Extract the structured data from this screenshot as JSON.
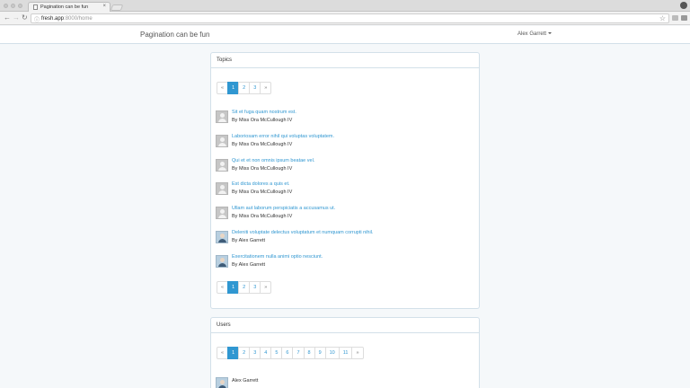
{
  "browser": {
    "tab_title": "Pagination can be fun",
    "tab_close": "×",
    "url_host": "fresh.app",
    "url_rest": ":8000/home",
    "nav_back": "←",
    "nav_forward": "→",
    "nav_reload": "↻",
    "star": "☆"
  },
  "app": {
    "brand": "Pagination can be fun",
    "user_name": "Alex Garrett"
  },
  "topics_panel": {
    "heading": "Topics",
    "pagination": [
      "«",
      "1",
      "2",
      "3",
      "»"
    ],
    "active_page": "1",
    "topics": [
      {
        "title": "Sit et fuga quam nostrum est.",
        "author": "By Miss Ora McCullough IV",
        "avatar": "default"
      },
      {
        "title": "Laboriosam error nihil qui voluptas voluptatem.",
        "author": "By Miss Ora McCullough IV",
        "avatar": "default"
      },
      {
        "title": "Qui et et non omnis ipsum beatae vel.",
        "author": "By Miss Ora McCullough IV",
        "avatar": "default"
      },
      {
        "title": "Est dicta dolores a quis et.",
        "author": "By Miss Ora McCullough IV",
        "avatar": "default"
      },
      {
        "title": "Ullam aut laborum perspiciatis a accusamus ut.",
        "author": "By Miss Ora McCullough IV",
        "avatar": "default"
      },
      {
        "title": "Deleniti voluptate delectus voluptatum et numquam corrupti nihil.",
        "author": "By Alex Garrett",
        "avatar": "photo"
      },
      {
        "title": "Exercitationem nulla animi optio nesciunt.",
        "author": "By Alex Garrett",
        "avatar": "photo"
      }
    ]
  },
  "users_panel": {
    "heading": "Users",
    "pagination": [
      "«",
      "1",
      "2",
      "3",
      "4",
      "5",
      "6",
      "7",
      "8",
      "9",
      "10",
      "11",
      "»"
    ],
    "active_page": "1",
    "users": [
      {
        "name": "Alex Garrett",
        "avatar": "photo"
      }
    ]
  },
  "colors": {
    "link": "#3097d1",
    "page_bg": "#f5f8fa",
    "panel_border": "#d3e0e9"
  }
}
